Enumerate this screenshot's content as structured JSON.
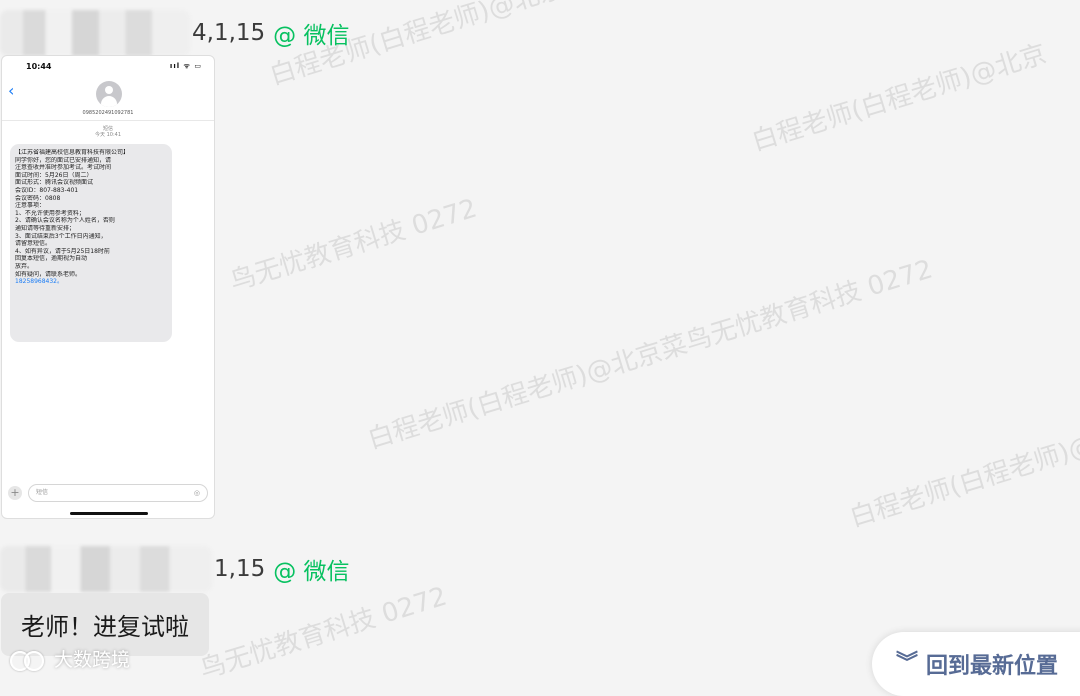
{
  "watermark": {
    "teacher": "白程老师(白程老师)@北京菜鸟无忧教育科技 0272",
    "teacher_short": "白程老师(白程老师)@北京",
    "company": "鸟无忧教育科技 0272"
  },
  "messages": [
    {
      "time": "4,1,15",
      "via": "@ 微信"
    },
    {
      "time": "1,15",
      "via": "@ 微信",
      "text": "老师！进复试啦"
    }
  ],
  "phone": {
    "status_time": "10:44",
    "status_signal": "ııl ᯤ ▭",
    "back": "‹",
    "sender_number": "0985202491092781",
    "meta_1": "短信",
    "meta_2": "今天 10:41",
    "sms_lines": [
      "【江苏省福建高校信息教育科技有限公司】",
      "同学你好，您的面试已安排通知，请",
      "注意查收并准时参加考试。考试时间",
      "面试时间：5月26日（周二）",
      "面试形式：腾讯会议视频面试",
      "会议ID：807-883-401",
      "会议密码：0808",
      "注意事项：",
      "1、不允许使用参考资料；",
      "2、请确认会议名称为个人姓名，否则",
      "通知请等待重新安排；",
      "3、面试结束后3个工作日内通知，",
      "请留意短信。",
      "4、如有异议，请于5月25日18时前",
      "回复本短信，逾期视为自动",
      "放弃。",
      "如有疑问，请联系老师。",
      "18258968432。"
    ],
    "input_placeholder": "短信",
    "input_plus": "+",
    "input_mic": "◎"
  },
  "logo": {
    "text": "大数跨境"
  },
  "scroll_button": {
    "label": "回到最新位置",
    "icon": "double-chevron-down-icon"
  },
  "colors": {
    "wechat_green": "#07c160",
    "link_blue": "#576b95",
    "ios_blue": "#1a7cf5"
  }
}
